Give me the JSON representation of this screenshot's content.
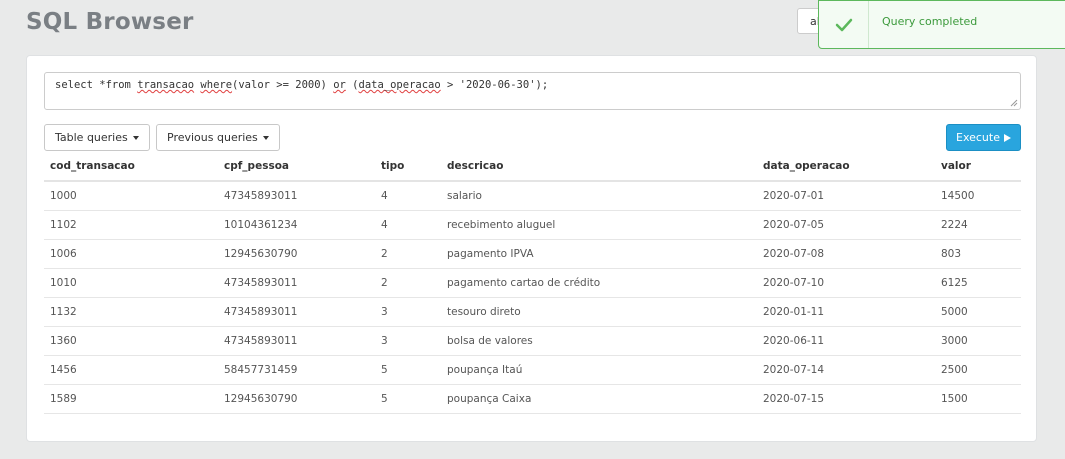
{
  "app": {
    "title": "SQL Browser"
  },
  "db_selector": {
    "value": "al"
  },
  "toast": {
    "message": "Query completed",
    "icon": "check-icon",
    "color": "#5cb85c"
  },
  "query": {
    "value": "select *from transacao where(valor >= 2000) or (data_operacao > '2020-06-30');",
    "parts": {
      "p1": "select *from ",
      "p2": "transacao",
      "p3": " ",
      "p4": "where",
      "p5": "(valor >= 2000) ",
      "p6": "or",
      "p7": " (",
      "p8": "data_operacao",
      "p9": " > '2020-06-30');"
    }
  },
  "toolbar": {
    "table_queries": "Table queries",
    "previous_queries": "Previous queries",
    "execute": "Execute",
    "execute_color": "#29a5de"
  },
  "table": {
    "columns": [
      "cod_transacao",
      "cpf_pessoa",
      "tipo",
      "descricao",
      "data_operacao",
      "valor"
    ],
    "rows": [
      [
        "1000",
        "47345893011",
        "4",
        "salario",
        "2020-07-01",
        "14500"
      ],
      [
        "1102",
        "10104361234",
        "4",
        "recebimento aluguel",
        "2020-07-05",
        "2224"
      ],
      [
        "1006",
        "12945630790",
        "2",
        "pagamento IPVA",
        "2020-07-08",
        "803"
      ],
      [
        "1010",
        "47345893011",
        "2",
        "pagamento cartao de crédito",
        "2020-07-10",
        "6125"
      ],
      [
        "1132",
        "47345893011",
        "3",
        "tesouro direto",
        "2020-01-11",
        "5000"
      ],
      [
        "1360",
        "47345893011",
        "3",
        "bolsa de valores",
        "2020-06-11",
        "3000"
      ],
      [
        "1456",
        "58457731459",
        "5",
        "poupança Itaú",
        "2020-07-14",
        "2500"
      ],
      [
        "1589",
        "12945630790",
        "5",
        "poupança Caixa",
        "2020-07-15",
        "1500"
      ]
    ]
  }
}
